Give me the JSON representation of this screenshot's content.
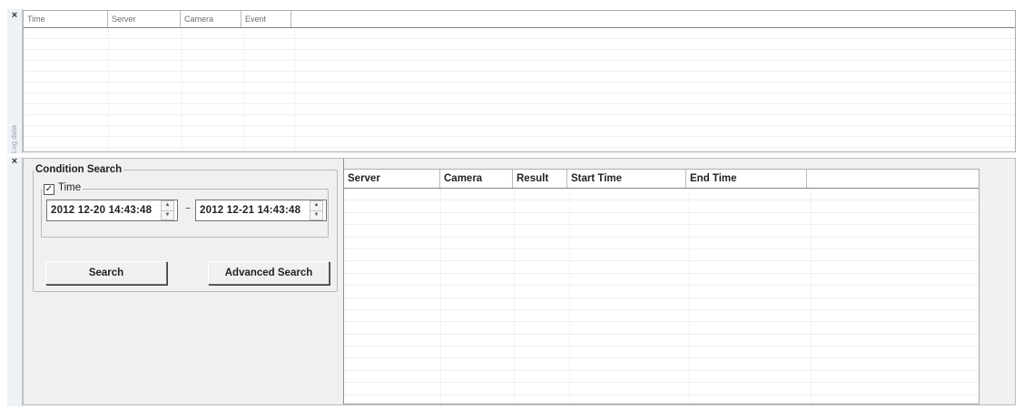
{
  "icons": {
    "close": "close-x-icon"
  },
  "top_panel": {
    "close_label": "×",
    "side_label": "Log data",
    "log_grid": {
      "columns": [
        "Time",
        "Server",
        "Camera",
        "Event"
      ],
      "empty_rows": 12
    }
  },
  "bottom_panel": {
    "close_label": "×",
    "condition_search": {
      "title": "Condition Search",
      "time": {
        "checkbox_mark": "✓",
        "label": "Time",
        "checked": true,
        "start": "2012 12-20 14:43:48",
        "dash": "~",
        "end": "2012 12-21 14:43:48",
        "spin_up": "▲",
        "spin_down": "▼"
      },
      "search_label": "Search",
      "advanced_label": "Advanced Search"
    },
    "results_grid": {
      "columns": [
        "Server",
        "Camera",
        "Result",
        "Start Time",
        "End Time"
      ],
      "empty_rows": 19
    }
  }
}
